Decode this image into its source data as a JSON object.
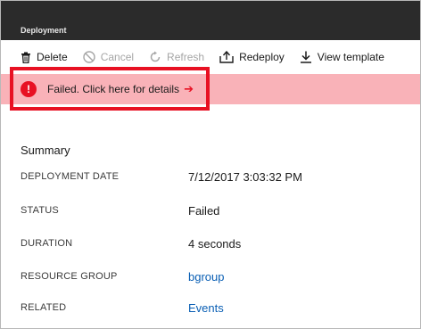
{
  "header": {
    "title": "Deployment"
  },
  "toolbar": {
    "items": [
      {
        "label": "Delete",
        "icon": "trash-icon",
        "disabled": false
      },
      {
        "label": "Cancel",
        "icon": "cancel-icon",
        "disabled": true
      },
      {
        "label": "Refresh",
        "icon": "refresh-icon",
        "disabled": true
      },
      {
        "label": "Redeploy",
        "icon": "upload-icon",
        "disabled": false
      },
      {
        "label": "View template",
        "icon": "download-icon",
        "disabled": false
      }
    ]
  },
  "banner": {
    "icon_text": "!",
    "message": "Failed. Click here for details",
    "arrow": "➔",
    "color": "#f9b2b8",
    "icon_color": "#e81123"
  },
  "summary": {
    "title": "Summary",
    "rows": [
      {
        "label": "DEPLOYMENT DATE",
        "value": "7/12/2017 3:03:32 PM",
        "link": false
      },
      {
        "label": "STATUS",
        "value": "Failed",
        "link": false
      },
      {
        "label": "DURATION",
        "value": "4 seconds",
        "link": false
      },
      {
        "label": "RESOURCE GROUP",
        "value": "bgroup",
        "link": true
      },
      {
        "label": "RELATED",
        "value": "Events",
        "link": true
      }
    ]
  }
}
